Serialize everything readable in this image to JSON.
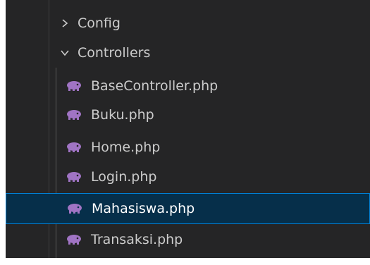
{
  "explorer": {
    "folders": [
      {
        "label": "Config",
        "state": "collapsed",
        "icon": "chevron-right-icon"
      },
      {
        "label": "Controllers",
        "state": "expanded",
        "icon": "chevron-down-icon"
      }
    ],
    "files": [
      {
        "label": "BaseController.php",
        "icon": "php-elephant-icon"
      },
      {
        "label": "Buku.php",
        "icon": "php-elephant-icon"
      },
      {
        "label": "Home.php",
        "icon": "php-elephant-icon"
      },
      {
        "label": "Login.php",
        "icon": "php-elephant-icon"
      },
      {
        "label": "Mahasiswa.php",
        "icon": "php-elephant-icon",
        "selected": true
      },
      {
        "label": "Transaksi.php",
        "icon": "php-elephant-icon"
      }
    ]
  },
  "colors": {
    "panel_background": "#252526",
    "text": "#cccccc",
    "selected_background": "#062f4a",
    "selected_border": "#007fd4",
    "php_icon": "#a074c4"
  }
}
